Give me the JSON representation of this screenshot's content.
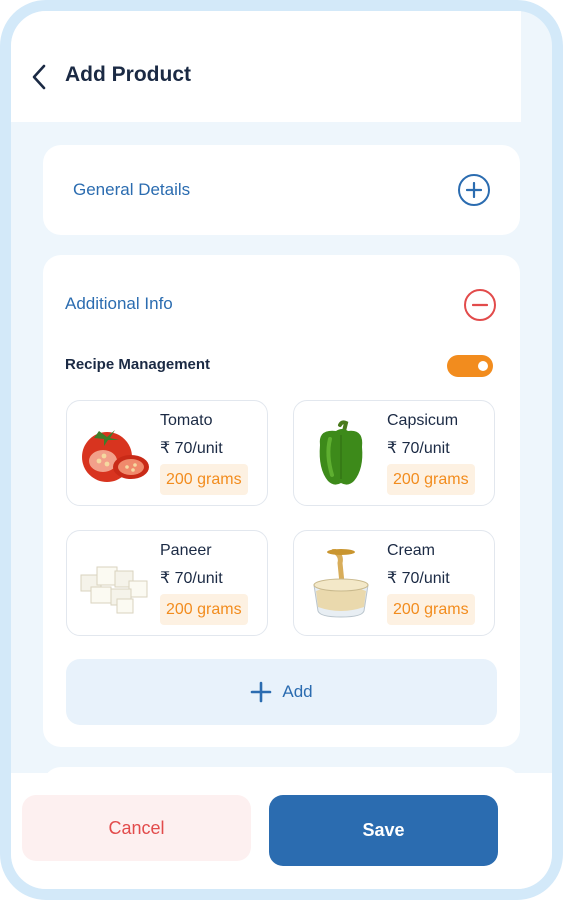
{
  "header": {
    "title": "Add Product"
  },
  "sections": {
    "general": {
      "title": "General Details"
    },
    "additional": {
      "title": "Additional Info",
      "recipe_label": "Recipe Management",
      "recipe_enabled": true
    }
  },
  "ingredients": [
    {
      "name": "Tomato",
      "price": "₹ 70/unit",
      "qty": "200 grams",
      "icon": "tomato-image"
    },
    {
      "name": "Capsicum",
      "price": "₹ 70/unit",
      "qty": "200 grams",
      "icon": "capsicum-image"
    },
    {
      "name": "Paneer",
      "price": "₹ 70/unit",
      "qty": "200 grams",
      "icon": "paneer-image"
    },
    {
      "name": "Cream",
      "price": "₹ 70/unit",
      "qty": "200 grams",
      "icon": "cream-image"
    }
  ],
  "add_label": "Add",
  "footer": {
    "cancel": "Cancel",
    "save": "Save"
  },
  "colors": {
    "primary": "#2b6cb0",
    "danger": "#e24b4b",
    "accent": "#f28c1e",
    "background": "#eef6fc"
  }
}
